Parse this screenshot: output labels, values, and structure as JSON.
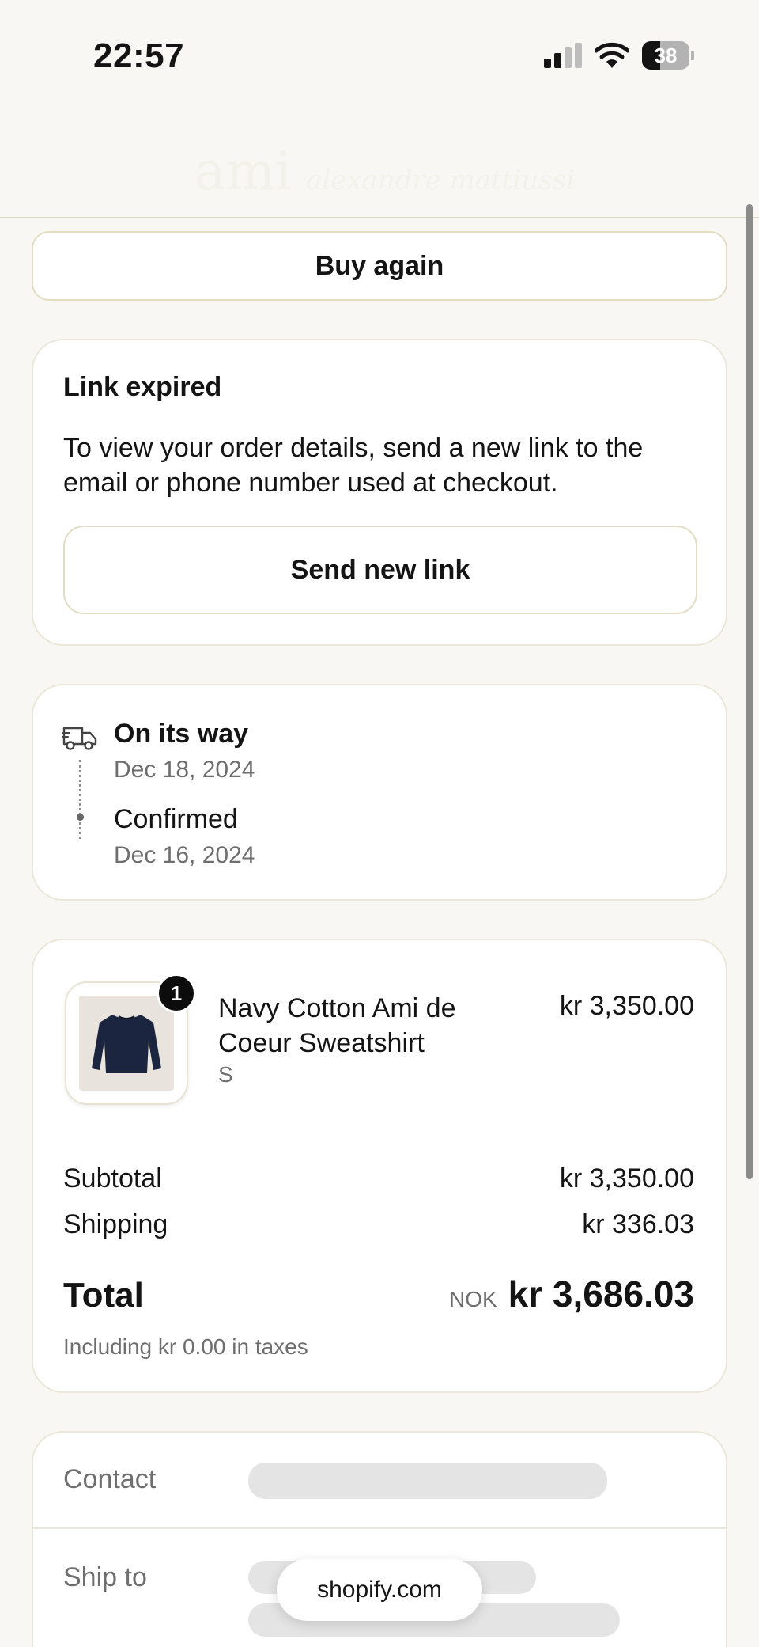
{
  "status_bar": {
    "time": "22:57",
    "battery": "38",
    "battery_level": 0.38
  },
  "header": {
    "logo_main": "ami",
    "logo_sub": "alexandre mattiussi"
  },
  "actions": {
    "buy_again": "Buy again"
  },
  "link_expired": {
    "title": "Link expired",
    "message": "To view your order details, send a new link to the email or phone number used at checkout.",
    "button": "Send new link"
  },
  "timeline": [
    {
      "status": "On its way",
      "date": "Dec 18, 2024"
    },
    {
      "status": "Confirmed",
      "date": "Dec 16, 2024"
    }
  ],
  "order": {
    "item": {
      "name": "Navy Cotton Ami de Coeur Sweatshirt",
      "variant": "S",
      "price": "kr 3,350.00",
      "quantity": "1"
    },
    "subtotal_label": "Subtotal",
    "subtotal": "kr 3,350.00",
    "shipping_label": "Shipping",
    "shipping": "kr 336.03",
    "total_label": "Total",
    "currency": "NOK",
    "total": "kr 3,686.03",
    "tax_note": "Including kr 0.00 in taxes"
  },
  "details": {
    "contact_label": "Contact",
    "ship_to_label": "Ship to"
  },
  "browser": {
    "domain": "shopify.com"
  },
  "colors": {
    "background": "#f8f7f3",
    "card": "#ffffff",
    "border": "#e2dcc2",
    "text": "#141414",
    "muted": "#6e6e6e"
  },
  "icons": [
    "cellular-signal-icon",
    "wifi-icon",
    "battery-icon",
    "delivery-truck-icon",
    "sweatshirt-image"
  ]
}
